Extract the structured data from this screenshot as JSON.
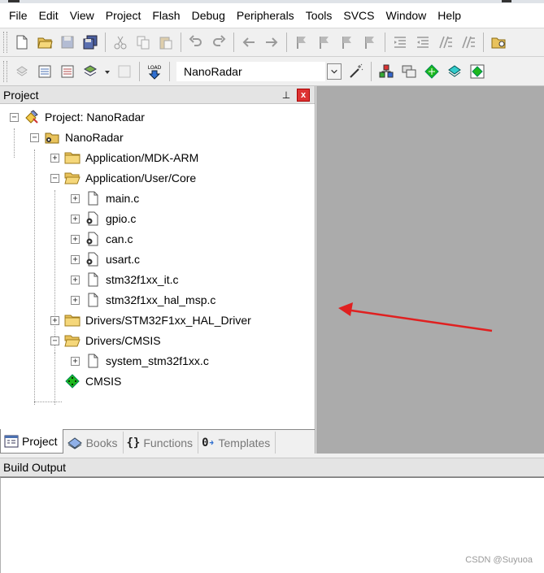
{
  "menubar": {
    "items": [
      "File",
      "Edit",
      "View",
      "Project",
      "Flash",
      "Debug",
      "Peripherals",
      "Tools",
      "SVCS",
      "Window",
      "Help"
    ]
  },
  "toolbar": {
    "target_value": "NanoRadar",
    "load_label": "LOAD"
  },
  "project_panel": {
    "title": "Project",
    "pin_glyph": "⊥",
    "close_glyph": "x",
    "tree": [
      {
        "label": "Project: NanoRadar",
        "icon": "project-icon",
        "expander": "−"
      },
      {
        "label": "NanoRadar",
        "icon": "target-folder-icon",
        "expander": "−"
      },
      {
        "label": "Application/MDK-ARM",
        "icon": "folder-closed-icon",
        "expander": "+"
      },
      {
        "label": "Application/User/Core",
        "icon": "folder-open-icon",
        "expander": "−"
      },
      {
        "label": "main.c",
        "icon": "file-icon",
        "expander": "+"
      },
      {
        "label": "gpio.c",
        "icon": "file-gear-icon",
        "expander": "+"
      },
      {
        "label": "can.c",
        "icon": "file-gear-icon",
        "expander": "+"
      },
      {
        "label": "usart.c",
        "icon": "file-gear-icon",
        "expander": "+"
      },
      {
        "label": "stm32f1xx_it.c",
        "icon": "file-icon",
        "expander": "+"
      },
      {
        "label": "stm32f1xx_hal_msp.c",
        "icon": "file-icon",
        "expander": "+"
      },
      {
        "label": "Drivers/STM32F1xx_HAL_Driver",
        "icon": "folder-closed-icon",
        "expander": "+"
      },
      {
        "label": "Drivers/CMSIS",
        "icon": "folder-open-icon",
        "expander": "−"
      },
      {
        "label": "system_stm32f1xx.c",
        "icon": "file-icon",
        "expander": "+"
      },
      {
        "label": "CMSIS",
        "icon": "cmsis-diamond-icon",
        "expander": ""
      }
    ],
    "tabs": [
      {
        "label": "Project",
        "icon": "project-tab-icon",
        "active": true
      },
      {
        "label": "Books",
        "icon": "books-icon",
        "active": false
      },
      {
        "label": "Functions",
        "icon": "functions-braces-icon",
        "glyph": "{}",
        "active": false
      },
      {
        "label": "Templates",
        "icon": "templates-icon",
        "glyph": "0",
        "active": false
      }
    ]
  },
  "build_output": {
    "title": "Build Output"
  },
  "watermark": "CSDN @Suyuoa",
  "colors": {
    "folder": "#e8c25c",
    "arrow": "#e02020",
    "gray_area": "#ababab",
    "cmsis_green": "#1db81d"
  }
}
